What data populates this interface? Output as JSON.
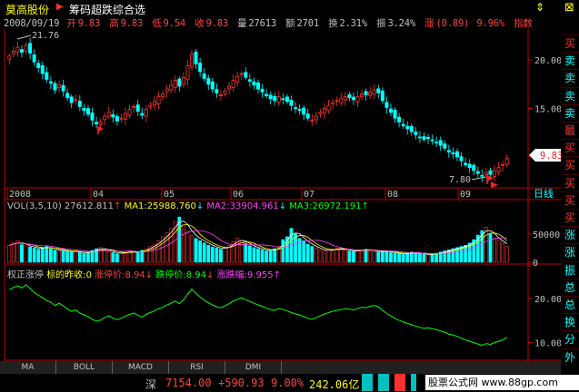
{
  "window": {
    "stock_name": "莫高股份",
    "strategy_name": "筹码超跌综合选",
    "icons": [
      "up-down-arrows-icon",
      "close-icon"
    ]
  },
  "quote": {
    "date": "2008/09/19",
    "open_label": "开",
    "open": "9.83",
    "high_label": "高",
    "high": "9.83",
    "low_label": "低",
    "low": "9.54",
    "close_label": "收",
    "close": "9.83",
    "volume_label": "量",
    "volume": "27613",
    "amount_label": "额",
    "amount": "2701",
    "turnover_label": "换",
    "turnover": "2.31%",
    "amplitude_label": "振",
    "amplitude": "3.24%",
    "change_label": "涨",
    "change": "(0.89)",
    "change_pct": "9.96%",
    "index_label": "指数"
  },
  "main_chart": {
    "high_marker": "21.76",
    "low_marker": "7.80",
    "current_price": "9.83",
    "y_ticks": [
      "20.00",
      "15.00",
      "10.00"
    ],
    "month_labels": [
      "2008",
      "04",
      "05",
      "06",
      "07",
      "08",
      "09"
    ],
    "period_label": "日线",
    "colors": {
      "up": "#ff3232",
      "down": "#00ffff",
      "axis": "#c00000"
    }
  },
  "volume_panel": {
    "title": "VOL(3,5,10)",
    "vol": "27612.811",
    "ma1_label": "MA1:",
    "ma1": "25988.760",
    "ma2_label": "MA2:",
    "ma2": "33904.961",
    "ma3_label": "MA3:",
    "ma3": "26972.191",
    "y_ticks": [
      "50000",
      "0"
    ]
  },
  "indicator_panel": {
    "title": "权正涨停",
    "t1_label": "标的昨收:",
    "t1": "0",
    "t2_label": "涨停价:",
    "t2": "8.94",
    "t3_label": "跌停价:",
    "t3": "8.94",
    "t4_label": "涨跌幅:",
    "t4": "9.955",
    "y_ticks": [
      "20.00",
      "10.00"
    ]
  },
  "sidebar": {
    "buttons": [
      "买",
      "卖",
      "卖",
      "卖",
      "卖",
      "最",
      "买",
      "买",
      "买",
      "买",
      "买",
      "涨",
      "涨",
      "振",
      "总",
      "总",
      "换",
      "分",
      "外"
    ]
  },
  "tabs": [
    "MA",
    "BOLL",
    "MACD",
    "RSI",
    "DMI"
  ],
  "ticker": {
    "market": "深",
    "index_value": "7154.00",
    "index_change": "+590.93",
    "index_pct": "9.00%",
    "turnover": "242.06亿",
    "site_text": "股票公式网 www.88gp.com"
  },
  "chart_data": [
    {
      "type": "candlestick",
      "x": "trading days 2008-01 to 2008-09-19",
      "ylim": [
        7,
        23
      ],
      "closes": [
        20.4,
        20.9,
        21.3,
        20.8,
        21.5,
        20.7,
        19.8,
        19.2,
        18.6,
        18.0,
        17.6,
        16.9,
        17.4,
        16.8,
        16.1,
        15.6,
        15.9,
        15.2,
        14.8,
        14.4,
        13.8,
        13.4,
        13.6,
        14.2,
        14.6,
        14.1,
        13.7,
        14.0,
        14.5,
        14.9,
        15.2,
        14.7,
        14.3,
        14.9,
        15.3,
        15.7,
        16.2,
        16.5,
        17.0,
        17.4,
        17.9,
        17.3,
        18.2,
        19.4,
        20.6,
        19.6,
        18.8,
        18.1,
        17.5,
        17.0,
        16.6,
        16.4,
        16.8,
        17.3,
        17.9,
        18.3,
        18.6,
        18.2,
        17.8,
        17.4,
        17.0,
        16.7,
        16.3,
        16.0,
        15.8,
        16.2,
        16.0,
        15.7,
        15.3,
        15.0,
        14.8,
        14.4,
        14.0,
        13.8,
        14.2,
        14.6,
        15.0,
        15.3,
        15.6,
        15.8,
        16.0,
        16.2,
        16.1,
        15.9,
        16.2,
        16.5,
        16.4,
        16.7,
        16.9,
        16.6,
        15.8,
        15.1,
        14.6,
        14.0,
        13.6,
        13.2,
        12.9,
        12.6,
        12.3,
        12.0,
        11.8,
        11.9,
        11.7,
        11.5,
        11.2,
        10.9,
        10.5,
        10.3,
        10.0,
        9.6,
        9.2,
        8.9,
        8.6,
        8.3,
        8.0,
        8.4,
        8.2,
        8.6,
        8.9,
        9.2,
        9.83
      ],
      "high": 21.76,
      "low": 7.8
    },
    {
      "type": "bar",
      "series": "volume",
      "y_ticks": [
        0,
        50000
      ],
      "ylim": [
        0,
        85000
      ],
      "values": [
        30000,
        34000,
        38000,
        31000,
        29000,
        27000,
        25000,
        23000,
        26000,
        28000,
        24000,
        22000,
        20000,
        21000,
        19000,
        18000,
        20000,
        17000,
        16000,
        18000,
        21000,
        24000,
        26000,
        22000,
        19000,
        17000,
        15000,
        16000,
        18000,
        20000,
        19000,
        17000,
        21000,
        24000,
        28000,
        32000,
        38000,
        45000,
        52000,
        60000,
        72000,
        80000,
        66000,
        55000,
        47000,
        42000,
        38000,
        34000,
        30000,
        27000,
        25000,
        23000,
        26000,
        30000,
        36000,
        42000,
        38000,
        33000,
        29000,
        26000,
        24000,
        22000,
        20000,
        21000,
        24000,
        28000,
        40000,
        45000,
        60000,
        50000,
        42000,
        38000,
        32000,
        28000,
        25000,
        22000,
        20000,
        21000,
        23000,
        25000,
        24000,
        22000,
        20000,
        19000,
        21000,
        22000,
        23000,
        21000,
        19000,
        18000,
        20000,
        19000,
        17000,
        16000,
        15000,
        14000,
        16000,
        18000,
        17000,
        15000,
        14000,
        13000,
        15000,
        16000,
        18000,
        20000,
        22000,
        24000,
        26000,
        28000,
        30000,
        34000,
        40000,
        48000,
        56000,
        62000,
        50000,
        42000,
        38000,
        33000,
        27612
      ]
    },
    {
      "type": "line",
      "series": "rights-adjusted close",
      "ylim": [
        7,
        26
      ]
    }
  ]
}
